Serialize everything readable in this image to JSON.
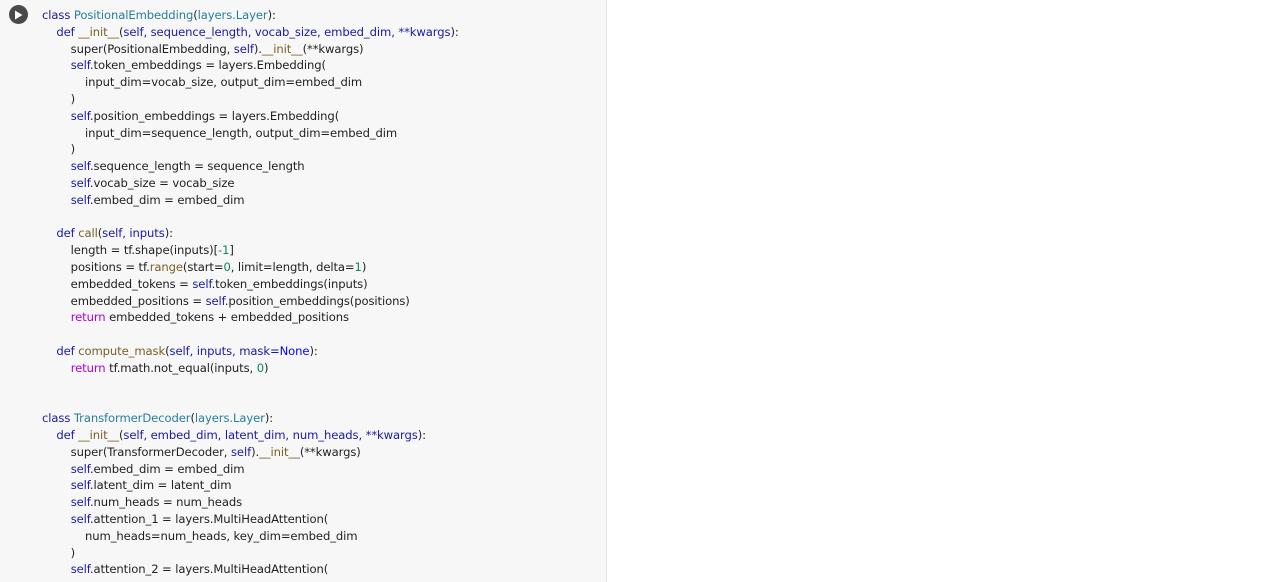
{
  "editor": {
    "run_icon": "play-icon",
    "colors": {
      "keyword": "#1a1aa6",
      "class_name": "#267f99",
      "function_name": "#795e26",
      "return_keyword": "#af00db",
      "number": "#098658",
      "background": "#f7f7f7"
    },
    "lines": [
      [
        {
          "t": "class ",
          "c": "kw"
        },
        {
          "t": "PositionalEmbedding",
          "c": "cls"
        },
        {
          "t": "(",
          "c": "dflt"
        },
        {
          "t": "layers.Layer",
          "c": "cls"
        },
        {
          "t": "):",
          "c": "dflt"
        }
      ],
      [
        {
          "t": "    "
        },
        {
          "t": "def ",
          "c": "kw"
        },
        {
          "t": "__init__",
          "c": "fn"
        },
        {
          "t": "(",
          "c": "dflt"
        },
        {
          "t": "self, sequence_length, vocab_size, embed_dim, **kwargs",
          "c": "kw"
        },
        {
          "t": "):",
          "c": "dflt"
        }
      ],
      [
        {
          "t": "        super(PositionalEmbedding, "
        },
        {
          "t": "self",
          "c": "slf"
        },
        {
          "t": ")."
        },
        {
          "t": "__init__",
          "c": "fn"
        },
        {
          "t": "(**kwargs)"
        }
      ],
      [
        {
          "t": "        "
        },
        {
          "t": "self",
          "c": "slf"
        },
        {
          "t": ".token_embeddings = layers.Embedding("
        }
      ],
      [
        {
          "t": "            input_dim=vocab_size, output_dim=embed_dim"
        }
      ],
      [
        {
          "t": "        )"
        }
      ],
      [
        {
          "t": "        "
        },
        {
          "t": "self",
          "c": "slf"
        },
        {
          "t": ".position_embeddings = layers.Embedding("
        }
      ],
      [
        {
          "t": "            input_dim=sequence_length, output_dim=embed_dim"
        }
      ],
      [
        {
          "t": "        )"
        }
      ],
      [
        {
          "t": "        "
        },
        {
          "t": "self",
          "c": "slf"
        },
        {
          "t": ".sequence_length = sequence_length"
        }
      ],
      [
        {
          "t": "        "
        },
        {
          "t": "self",
          "c": "slf"
        },
        {
          "t": ".vocab_size = vocab_size"
        }
      ],
      [
        {
          "t": "        "
        },
        {
          "t": "self",
          "c": "slf"
        },
        {
          "t": ".embed_dim = embed_dim"
        }
      ],
      [
        {
          "t": ""
        }
      ],
      [
        {
          "t": "    "
        },
        {
          "t": "def ",
          "c": "kw"
        },
        {
          "t": "call",
          "c": "fn"
        },
        {
          "t": "("
        },
        {
          "t": "self, inputs",
          "c": "kw"
        },
        {
          "t": "):"
        }
      ],
      [
        {
          "t": "        length = tf.shape(inputs)["
        },
        {
          "t": "-1",
          "c": "num"
        },
        {
          "t": "]"
        }
      ],
      [
        {
          "t": "        positions = tf."
        },
        {
          "t": "range",
          "c": "fn"
        },
        {
          "t": "(start="
        },
        {
          "t": "0",
          "c": "num"
        },
        {
          "t": ", limit=length, delta="
        },
        {
          "t": "1",
          "c": "num"
        },
        {
          "t": ")"
        }
      ],
      [
        {
          "t": "        embedded_tokens = "
        },
        {
          "t": "self",
          "c": "slf"
        },
        {
          "t": ".token_embeddings(inputs)"
        }
      ],
      [
        {
          "t": "        embedded_positions = "
        },
        {
          "t": "self",
          "c": "slf"
        },
        {
          "t": ".position_embeddings(positions)"
        }
      ],
      [
        {
          "t": "        "
        },
        {
          "t": "return",
          "c": "ret"
        },
        {
          "t": " embedded_tokens + embedded_positions"
        }
      ],
      [
        {
          "t": ""
        }
      ],
      [
        {
          "t": "    "
        },
        {
          "t": "def ",
          "c": "kw"
        },
        {
          "t": "compute_mask",
          "c": "fn"
        },
        {
          "t": "("
        },
        {
          "t": "self, inputs, mask=",
          "c": "kw"
        },
        {
          "t": "None",
          "c": "cst"
        },
        {
          "t": "):"
        }
      ],
      [
        {
          "t": "        "
        },
        {
          "t": "return",
          "c": "ret"
        },
        {
          "t": " tf.math.not_equal(inputs, "
        },
        {
          "t": "0",
          "c": "num"
        },
        {
          "t": ")"
        }
      ],
      [
        {
          "t": ""
        }
      ],
      [
        {
          "t": ""
        }
      ],
      [
        {
          "t": "class ",
          "c": "kw"
        },
        {
          "t": "TransformerDecoder",
          "c": "cls"
        },
        {
          "t": "("
        },
        {
          "t": "layers.Layer",
          "c": "cls"
        },
        {
          "t": "):"
        }
      ],
      [
        {
          "t": "    "
        },
        {
          "t": "def ",
          "c": "kw"
        },
        {
          "t": "__init__",
          "c": "fn"
        },
        {
          "t": "("
        },
        {
          "t": "self, embed_dim, latent_dim, num_heads, **kwargs",
          "c": "kw"
        },
        {
          "t": "):"
        }
      ],
      [
        {
          "t": "        super(TransformerDecoder, "
        },
        {
          "t": "self",
          "c": "slf"
        },
        {
          "t": ")."
        },
        {
          "t": "__init__",
          "c": "fn"
        },
        {
          "t": "(**kwargs)"
        }
      ],
      [
        {
          "t": "        "
        },
        {
          "t": "self",
          "c": "slf"
        },
        {
          "t": ".embed_dim = embed_dim"
        }
      ],
      [
        {
          "t": "        "
        },
        {
          "t": "self",
          "c": "slf"
        },
        {
          "t": ".latent_dim = latent_dim"
        }
      ],
      [
        {
          "t": "        "
        },
        {
          "t": "self",
          "c": "slf"
        },
        {
          "t": ".num_heads = num_heads"
        }
      ],
      [
        {
          "t": "        "
        },
        {
          "t": "self",
          "c": "slf"
        },
        {
          "t": ".attention_1 = layers.MultiHeadAttention("
        }
      ],
      [
        {
          "t": "            num_heads=num_heads, key_dim=embed_dim"
        }
      ],
      [
        {
          "t": "        )"
        }
      ],
      [
        {
          "t": "        "
        },
        {
          "t": "self",
          "c": "slf"
        },
        {
          "t": ".attention_2 = layers.MultiHeadAttention("
        }
      ]
    ]
  }
}
